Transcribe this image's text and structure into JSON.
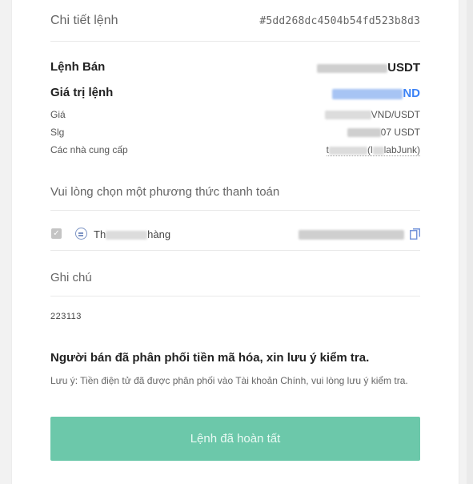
{
  "header": {
    "title": "Chi tiết lệnh",
    "order_id": "#5dd268dc4504b54fd523b8d3"
  },
  "order": {
    "type_label": "Lệnh Bán",
    "type_value_suffix": "USDT",
    "value_label": "Giá trị lệnh",
    "value_suffix": "ND",
    "price_label": "Giá",
    "price_value_suffix": "VND/USDT",
    "qty_label": "Slg",
    "qty_value_suffix": "07  USDT",
    "provider_label": "Các nhà cung cấp",
    "provider_value_prefix": "t",
    "provider_value_suffix": "(l",
    "provider_value_tail": "labJunk)"
  },
  "payment": {
    "section_title": "Vui lòng chọn một phương thức thanh toán",
    "method_prefix": "Th",
    "method_suffix": "hàng"
  },
  "note": {
    "section_title": "Ghi chú",
    "value": "223113"
  },
  "notice": {
    "title": "Người bán đã phân phối tiền mã hóa, xin lưu ý kiểm tra.",
    "detail": "Lưu ý: Tiền điện tử đã được phân phối vào Tài khoản Chính, vui lòng lưu ý kiểm tra."
  },
  "action": {
    "done_label": "Lệnh đã hoàn tất"
  },
  "colors": {
    "button": "#6cc8aa",
    "link_blue": "#3b82f6"
  }
}
